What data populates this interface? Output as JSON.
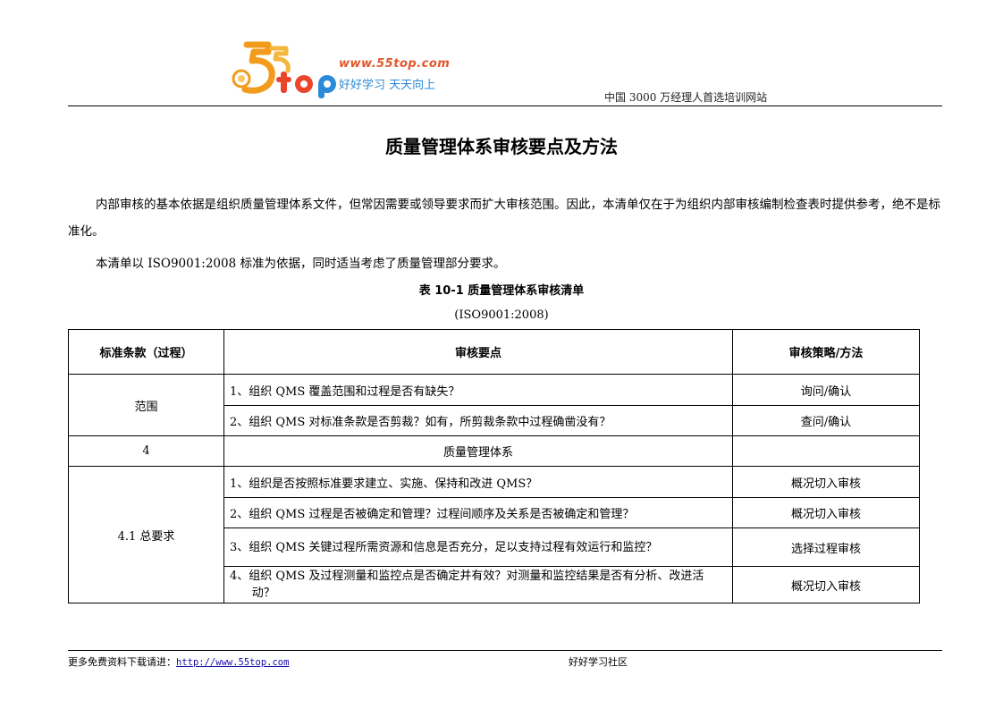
{
  "header": {
    "logo": {
      "brand": "55top",
      "url": "www.55top.com",
      "slogan": "好好学习  天天向上"
    },
    "tagline": "中国 3000 万经理人首选培训网站"
  },
  "document": {
    "title": "质量管理体系审核要点及方法",
    "paragraphs": [
      "内部审核的基本依据是组织质量管理体系文件，但常因需要或领导要求而扩大审核范围。因此，本清单仅在于为组织内部审核编制检查表时提供参考，绝不是标准化。",
      "本清单以 ISO9001:2008 标准为依据，同时适当考虑了质量管理部分要求。"
    ],
    "table_title": "表 10-1  质量管理体系审核清单",
    "table_subtitle": "(ISO9001:2008)",
    "table": {
      "headers": [
        "标准条款（过程）",
        "审核要点",
        "审核策略/方法"
      ],
      "groups": [
        {
          "clause": "范围",
          "rows": [
            {
              "point": "1、组织 QMS 覆盖范围和过程是否有缺失？",
              "method": "询问/确认"
            },
            {
              "point": "2、组织 QMS 对标准条款是否剪裁？如有，所剪裁条款中过程确凿没有？",
              "method": "查问/确认"
            }
          ]
        },
        {
          "clause": "4",
          "rows": [
            {
              "point": "质量管理体系",
              "method": ""
            }
          ]
        },
        {
          "clause": "4.1  总要求",
          "rows": [
            {
              "point": "1、组织是否按照标准要求建立、实施、保持和改进 QMS？",
              "method": "概况切入审核"
            },
            {
              "point": "2、组织 QMS 过程是否被确定和管理？过程间顺序及关系是否被确定和管理？",
              "method": "概况切入审核"
            },
            {
              "point": "3、组织 QMS 关键过程所需资源和信息是否充分，足以支持过程有效运行和监控？",
              "method": "选择过程审核"
            },
            {
              "point": "4、组织 QMS 及过程测量和监控点是否确定并有效？对测量和监控结果是否有分析、改进活动？",
              "method": "概况切入审核"
            }
          ]
        }
      ]
    }
  },
  "footer": {
    "download_label": "更多免费资料下载请进：",
    "download_link": "http://www.55top.com",
    "community": "好好学习社区"
  }
}
